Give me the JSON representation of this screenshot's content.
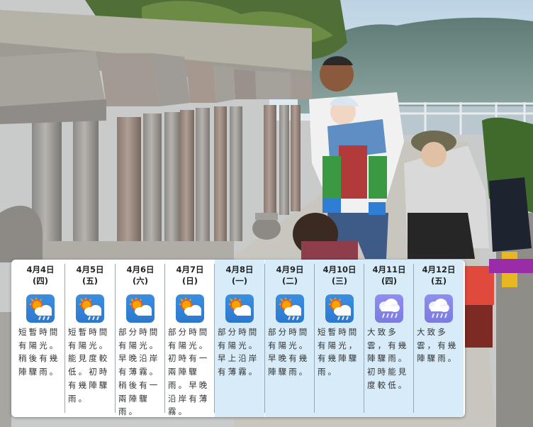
{
  "forecast": {
    "days": [
      {
        "date": "4月4日",
        "weekday": "(四)",
        "icon": "sun-cloud-rain-icon",
        "description": "短暫時間有陽光。稍後有幾陣驟雨。"
      },
      {
        "date": "4月5日",
        "weekday": "(五)",
        "icon": "sun-cloud-rain-icon",
        "description": "短暫時間有陽光。能見度較低。初時有幾陣驟雨。"
      },
      {
        "date": "4月6日",
        "weekday": "(六)",
        "icon": "sun-cloud-icon",
        "description": "部分時間有陽光。早晚沿岸有薄霧。稍後有一兩陣驟雨。"
      },
      {
        "date": "4月7日",
        "weekday": "(日)",
        "icon": "sun-cloud-icon",
        "description": "部分時間有陽光。初時有一兩陣驟雨。早晚沿岸有薄霧。"
      },
      {
        "date": "4月8日",
        "weekday": "(一)",
        "icon": "sun-cloud-icon",
        "description": "部分時間有陽光。早上沿岸有薄霧。"
      },
      {
        "date": "4月9日",
        "weekday": "(二)",
        "icon": "sun-cloud-rain-icon",
        "description": "部分時間有陽光。早晚有幾陣驟雨。"
      },
      {
        "date": "4月10日",
        "weekday": "(三)",
        "icon": "sun-cloud-rain-icon",
        "description": "短暫時間有陽光，有幾陣驟雨。"
      },
      {
        "date": "4月11日",
        "weekday": "(四)",
        "icon": "cloud-rain-icon",
        "description": "大致多雲，有幾陣驟雨。初時能見度較低。"
      },
      {
        "date": "4月12日",
        "weekday": "(五)",
        "icon": "cloud-rain-icon",
        "description": "大致多雲，有幾陣驟雨。"
      }
    ]
  }
}
